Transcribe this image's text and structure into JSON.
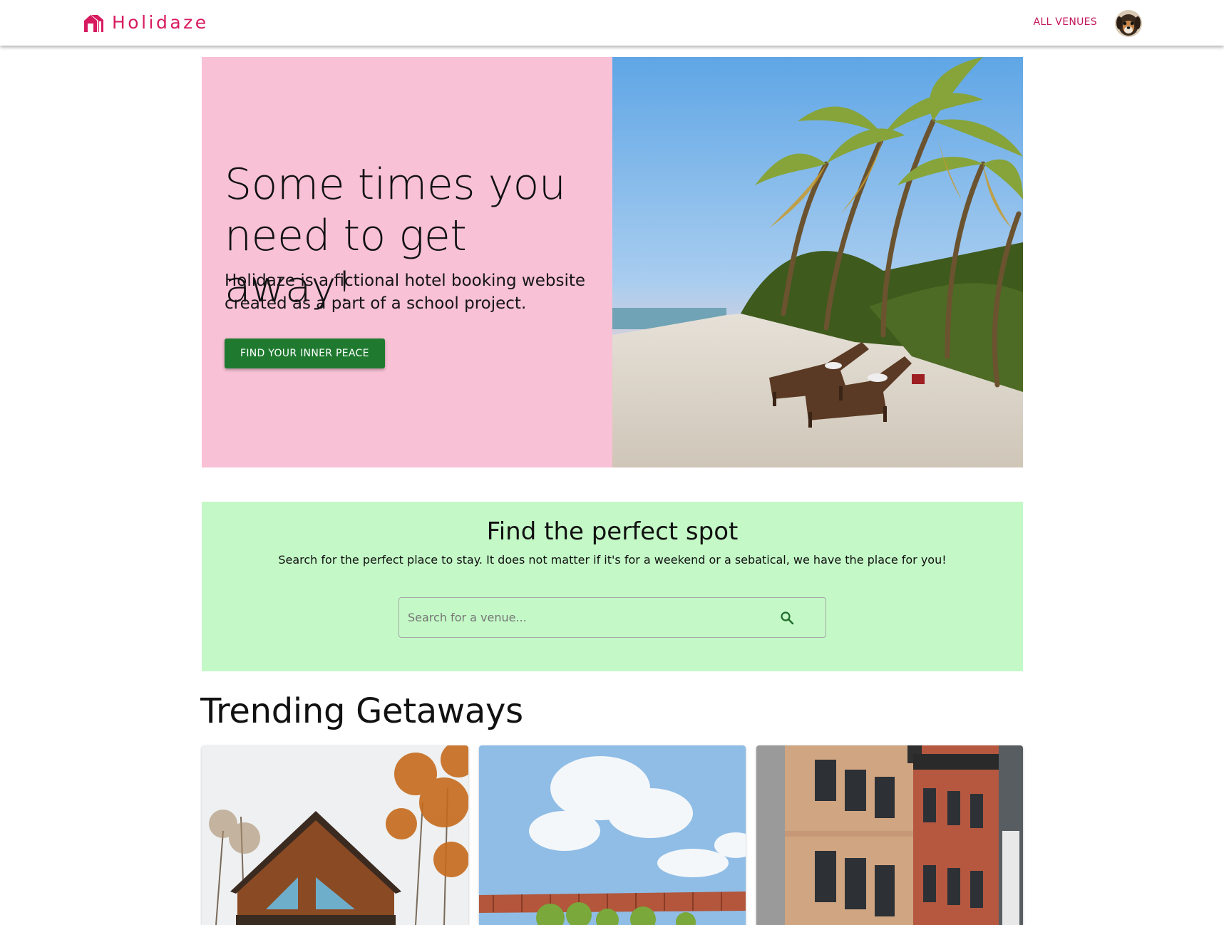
{
  "header": {
    "brand": "Holidaze",
    "nav_all_venues": "ALL VENUES",
    "brand_color": "#d81b60"
  },
  "hero": {
    "title": "Some times you need to get away!",
    "subtitle": "Holidaze is a fictional hotel booking website created as a part of a school project.",
    "cta": "FIND YOUR INNER PEACE",
    "bg_color": "#f8c1d5",
    "cta_color": "#1f7a30"
  },
  "search": {
    "title": "Find the perfect spot",
    "description": "Search for the perfect place to stay. It does not matter if it's for a weekend or a sebatical, we have the place for you!",
    "placeholder": "Search for a venue...",
    "bg_color": "#c4f9c7",
    "icon": "search-icon"
  },
  "trending": {
    "title": "Trending Getaways"
  }
}
